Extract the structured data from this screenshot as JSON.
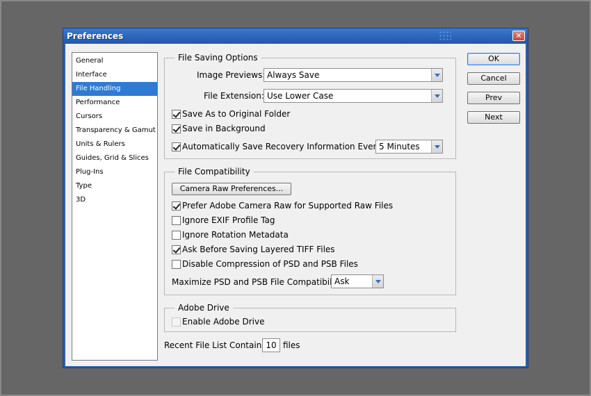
{
  "window": {
    "title": "Preferences",
    "close_glyph": "✕"
  },
  "sidebar": {
    "items": [
      {
        "label": "General"
      },
      {
        "label": "Interface"
      },
      {
        "label": "File Handling",
        "selected": true
      },
      {
        "label": "Performance"
      },
      {
        "label": "Cursors"
      },
      {
        "label": "Transparency & Gamut"
      },
      {
        "label": "Units & Rulers"
      },
      {
        "label": "Guides, Grid & Slices"
      },
      {
        "label": "Plug-Ins"
      },
      {
        "label": "Type"
      },
      {
        "label": "3D"
      }
    ]
  },
  "file_saving": {
    "title": "File Saving Options",
    "image_previews_label": "Image Previews:",
    "image_previews_value": "Always Save",
    "file_extension_label": "File Extension:",
    "file_extension_value": "Use Lower Case",
    "save_as_original_label": "Save As to Original Folder",
    "save_as_original_checked": true,
    "save_background_label": "Save in Background",
    "save_background_checked": true,
    "auto_save_label": "Automatically Save Recovery Information Every:",
    "auto_save_checked": true,
    "auto_save_value": "5 Minutes"
  },
  "file_compat": {
    "title": "File Compatibility",
    "camera_raw_button": "Camera Raw Preferences...",
    "prefer_acr_label": "Prefer Adobe Camera Raw for Supported Raw Files",
    "prefer_acr_checked": true,
    "ignore_exif_label": "Ignore EXIF Profile Tag",
    "ignore_exif_checked": false,
    "ignore_rotation_label": "Ignore Rotation Metadata",
    "ignore_rotation_checked": false,
    "ask_tiff_label": "Ask Before Saving Layered TIFF Files",
    "ask_tiff_checked": true,
    "disable_compression_label": "Disable Compression of PSD and PSB Files",
    "disable_compression_checked": false,
    "maximize_label": "Maximize PSD and PSB File Compatibility:",
    "maximize_value": "Ask"
  },
  "adobe_drive": {
    "title": "Adobe Drive",
    "enable_label": "Enable Adobe Drive",
    "enable_checked": false,
    "enable_disabled": true
  },
  "recent_files": {
    "label": "Recent File List Contains:",
    "value": "10",
    "suffix": "files"
  },
  "buttons": {
    "ok": "OK",
    "cancel": "Cancel",
    "prev": "Prev",
    "next": "Next"
  },
  "colors": {
    "title_bar": "#2b63b8",
    "selection": "#2f7bd3",
    "dialog_bg": "#f0f0f0"
  }
}
